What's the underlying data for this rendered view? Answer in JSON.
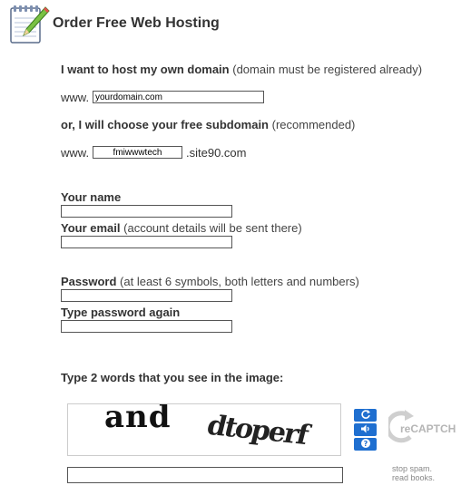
{
  "header": {
    "title": "Order Free Web Hosting",
    "icon": "notepad-pencil-icon"
  },
  "own_domain": {
    "label_bold": "I want to host my own domain",
    "label_note": "(domain must be registered already)",
    "prefix": "www.",
    "value": "yourdomain.com"
  },
  "subdomain": {
    "label_bold": "or, I will choose your free subdomain",
    "label_note": "(recommended)",
    "prefix": "www.",
    "value": "fmiwwwtech",
    "suffix": ".site90.com"
  },
  "name": {
    "label_bold": "Your name",
    "value": ""
  },
  "email": {
    "label_bold": "Your email",
    "label_note": "(account details will be sent there)",
    "value": ""
  },
  "password": {
    "label_bold": "Password",
    "label_note": "(at least 6 symbols, both letters and numbers)",
    "value": ""
  },
  "password_again": {
    "label_bold": "Type password again",
    "value": ""
  },
  "captcha": {
    "instruction": "Type 2 words that you see in the image:",
    "word1": "and",
    "word2": "dtoperf",
    "value": "",
    "buttons": [
      "refresh-icon",
      "audio-icon",
      "help-icon"
    ],
    "brand_text": "reCAPTCHA™",
    "tagline_1": "stop spam.",
    "tagline_2": "read books.",
    "accent_color": "#1f6fd0"
  }
}
